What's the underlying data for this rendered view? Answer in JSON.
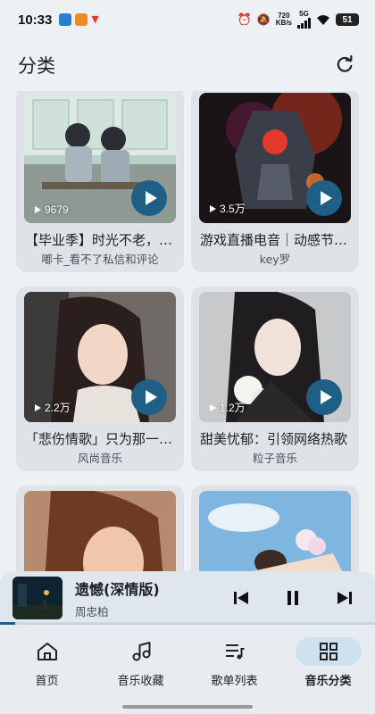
{
  "status_bar": {
    "time": "10:33",
    "net_speed_value": "720",
    "net_speed_unit": "KB/s",
    "network": "5G",
    "battery": "51"
  },
  "header": {
    "title": "分类"
  },
  "playlists": [
    {
      "title": "【毕业季】时光不老，我们不散",
      "author": "嘟卡_看不了私信和评论",
      "plays": "9679"
    },
    {
      "title": "游戏直播电音｜动感节奏燃爆全场",
      "author": "key罗",
      "plays": "3.5万"
    },
    {
      "title": "「悲伤情歌」只为那一个你",
      "author": "风尚音乐",
      "plays": "2.2万"
    },
    {
      "title": "甜美忧郁：引领网络热歌",
      "author": "粒子音乐",
      "plays": "1.2万"
    },
    {
      "title": "",
      "author": "",
      "plays": ""
    },
    {
      "title": "",
      "author": "",
      "plays": ""
    }
  ],
  "player": {
    "title": "遗憾(深情版)",
    "artist": "周忠柏",
    "progress": 0.04
  },
  "nav": {
    "home": "首页",
    "favorites": "音乐收藏",
    "playlist_list": "歌单列表",
    "categories": "音乐分类"
  }
}
